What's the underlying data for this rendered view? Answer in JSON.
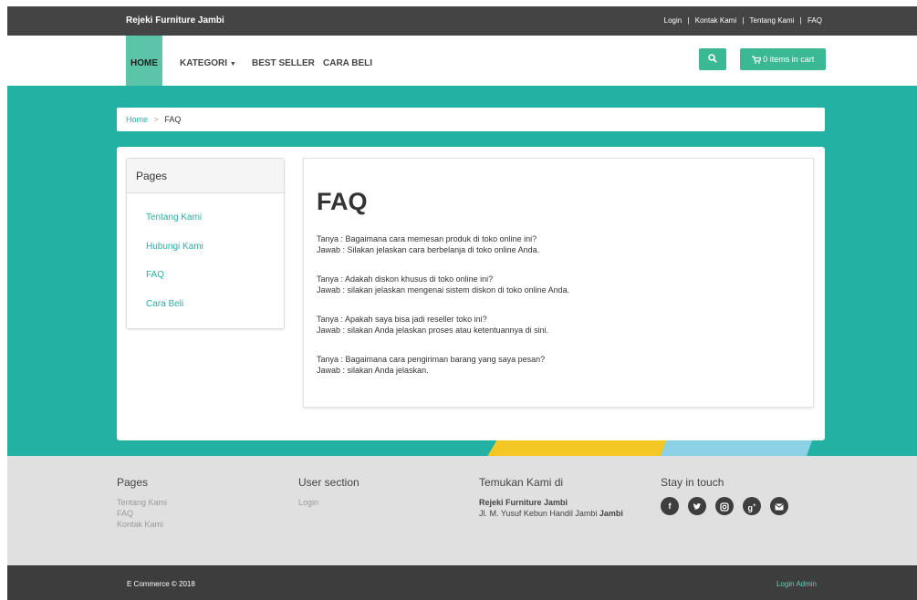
{
  "topbar": {
    "brand": "Rejeki Furniture Jambi",
    "links": [
      "Login",
      "Kontak Kami",
      "Tentang Kami",
      "FAQ"
    ],
    "separator": "|"
  },
  "nav": {
    "home": "HOME",
    "kategori": "KATEGORI",
    "best_seller": "BEST SELLER",
    "cara_beli": "CARA BELI",
    "cart": "0 items in cart"
  },
  "breadcrumb": {
    "home": "Home",
    "sep": ">",
    "current": "FAQ"
  },
  "sidebar": {
    "title": "Pages",
    "items": [
      "Tentang Kami",
      "Hubungi Kami",
      "FAQ",
      "Cara Beli"
    ]
  },
  "faq": {
    "title": "FAQ",
    "items": [
      {
        "q": "Tanya : Bagaimana cara memesan produk di toko online ini?",
        "a": "Jawab : Silakan jelaskan cara berbelanja di toko online Anda."
      },
      {
        "q": "Tanya : Adakah diskon khusus di toko online ini?",
        "a": "Jawab : silakan jelaskan mengenai sistem diskon di toko online Anda."
      },
      {
        "q": "Tanya : Apakah saya bisa jadi reseller toko ini?",
        "a": "Jawab : silakan Anda jelaskan proses atau ketentuannya di sini."
      },
      {
        "q": "Tanya : Bagaimana cara pengiriman barang yang saya pesan?",
        "a": "Jawab : silakan Anda jelaskan."
      }
    ]
  },
  "footer": {
    "pages_title": "Pages",
    "pages_links": [
      "Tentang Kami",
      "FAQ",
      "Kontak Kami"
    ],
    "user_title": "User section",
    "user_links": [
      "Login"
    ],
    "find_title": "Temukan Kami di",
    "store_name": "Rejeki Furniture Jambi",
    "address": "Jl. M. Yusuf Kebun Handil Jambi",
    "address_city": "Jambi",
    "stay_title": "Stay in touch",
    "social_icons": [
      "facebook-icon",
      "twitter-icon",
      "instagram-icon",
      "google-plus-icon",
      "email-icon"
    ]
  },
  "bottom": {
    "copyright": "E Commerce © 2018",
    "admin": "Login Admin"
  },
  "colors": {
    "teal": "#22b1a3",
    "accent_green": "#3bb894",
    "home_active": "#5cc4a8",
    "dark": "#444444"
  }
}
